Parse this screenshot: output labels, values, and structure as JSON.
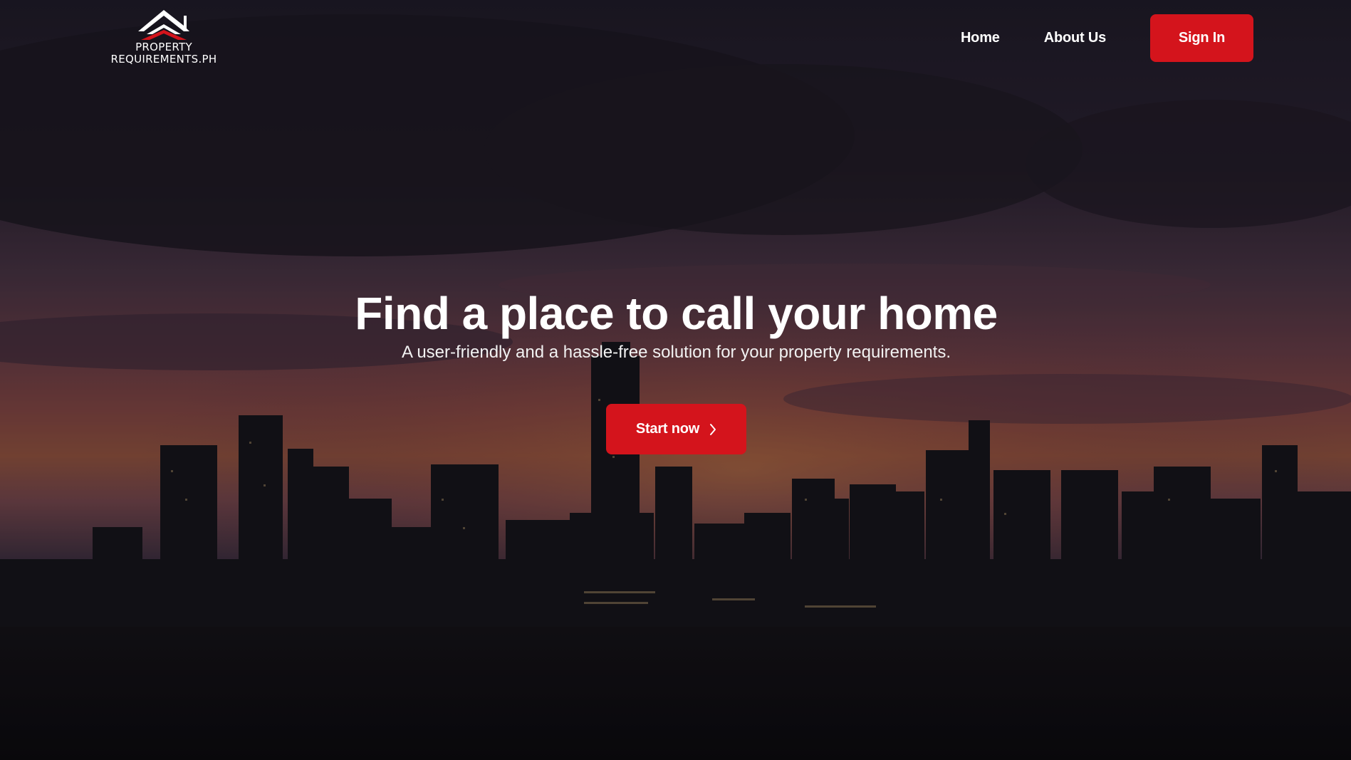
{
  "brand": {
    "line1": "PROPERTY",
    "line2": "REQUIREMENTS.PH",
    "icon": "house-roof-icon"
  },
  "nav": {
    "home": "Home",
    "about": "About Us",
    "signin": "Sign In"
  },
  "hero": {
    "title": "Find a place to call your home",
    "subtitle": "A user-friendly and a hassle-free solution for your property requirements.",
    "cta": "Start now",
    "cta_icon": "chevron-right-icon",
    "background": "city-skyline-sunset"
  },
  "colors": {
    "accent": "#d4141c",
    "text": "#ffffff"
  }
}
